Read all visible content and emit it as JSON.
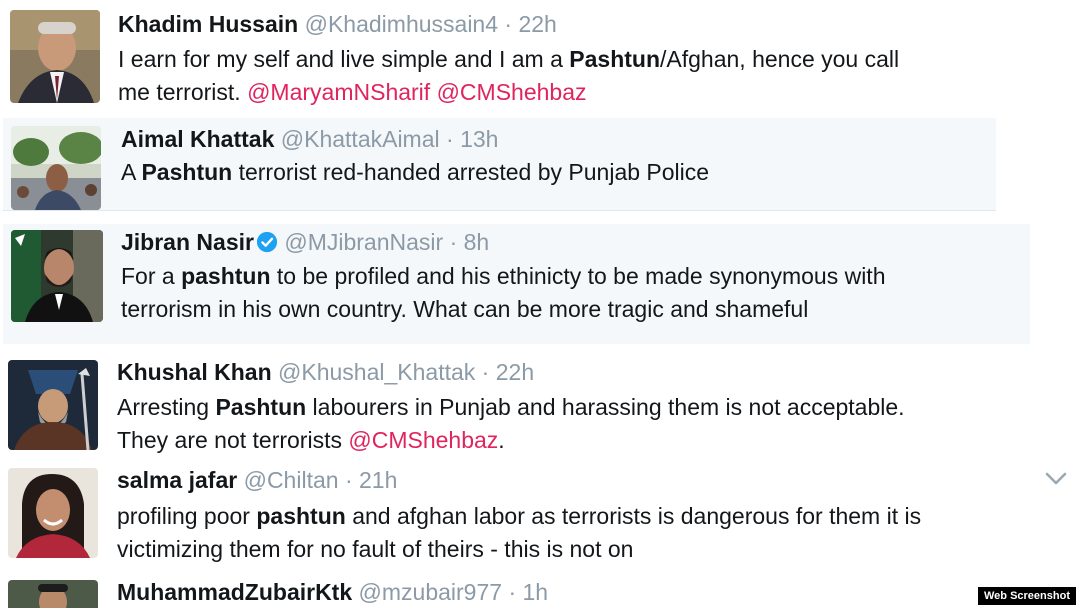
{
  "tweets": [
    {
      "name": "Khadim Hussain",
      "handle": "@Khadimhussain4",
      "sep": "·",
      "time": "22h",
      "line1": {
        "t1": "I earn for my self and live simple and I am a ",
        "b1": "Pashtun",
        "t2": "/Afghan, hence you call"
      },
      "line2": {
        "t1": "me terrorist. ",
        "m1": "@MaryamNSharif",
        "t2": " ",
        "m2": "@CMShehbaz"
      }
    },
    {
      "name": "Aimal Khattak",
      "handle": "@KhattakAimal",
      "sep": "·",
      "time": "13h",
      "line1": {
        "t1": "A ",
        "b1": "Pashtun",
        "t2": " terrorist red-handed arrested by Punjab Police"
      }
    },
    {
      "name": "Jibran Nasir",
      "handle": "@MJibranNasir",
      "sep": "·",
      "time": "8h",
      "verified_icon": "verified-badge-icon",
      "line1": {
        "t1": "For a ",
        "b1": "pashtun",
        "t2": " to be profiled and his ethinicty to be made synonymous with"
      },
      "line2": {
        "t1": "terrorism in his own country. What can be more tragic and shameful"
      }
    },
    {
      "name": "Khushal Khan",
      "handle": "@Khushal_Khattak",
      "sep": "·",
      "time": "22h",
      "line1": {
        "t1": "Arresting ",
        "b1": "Pashtun",
        "t2": " labourers in Punjab and harassing them is not acceptable."
      },
      "line2": {
        "t1": "They are not terrorists ",
        "m1": "@CMShehbaz",
        "t2": "."
      }
    },
    {
      "name": "salma jafar",
      "handle": "@Chiltan",
      "sep": "·",
      "time": "21h",
      "line1": {
        "t1": "profiling poor ",
        "b1": "pashtun",
        "t2": " and afghan labor as terrorists is dangerous for them it is"
      },
      "line2": {
        "t1": "victimizing them for no fault of theirs - this is not on"
      }
    },
    {
      "name": "MuhammadZubairKtk",
      "handle": "@mzubair977",
      "sep": "·",
      "time": "1h"
    }
  ],
  "icons": {
    "caret": "chevron-down-icon",
    "verified": "verified-badge-icon"
  },
  "colors": {
    "mention": "#e0245e",
    "muted": "#8b9aa6",
    "verified": "#1da1f2",
    "shaded_row": "#f5f8fa"
  },
  "watermark": "Web Screenshot"
}
